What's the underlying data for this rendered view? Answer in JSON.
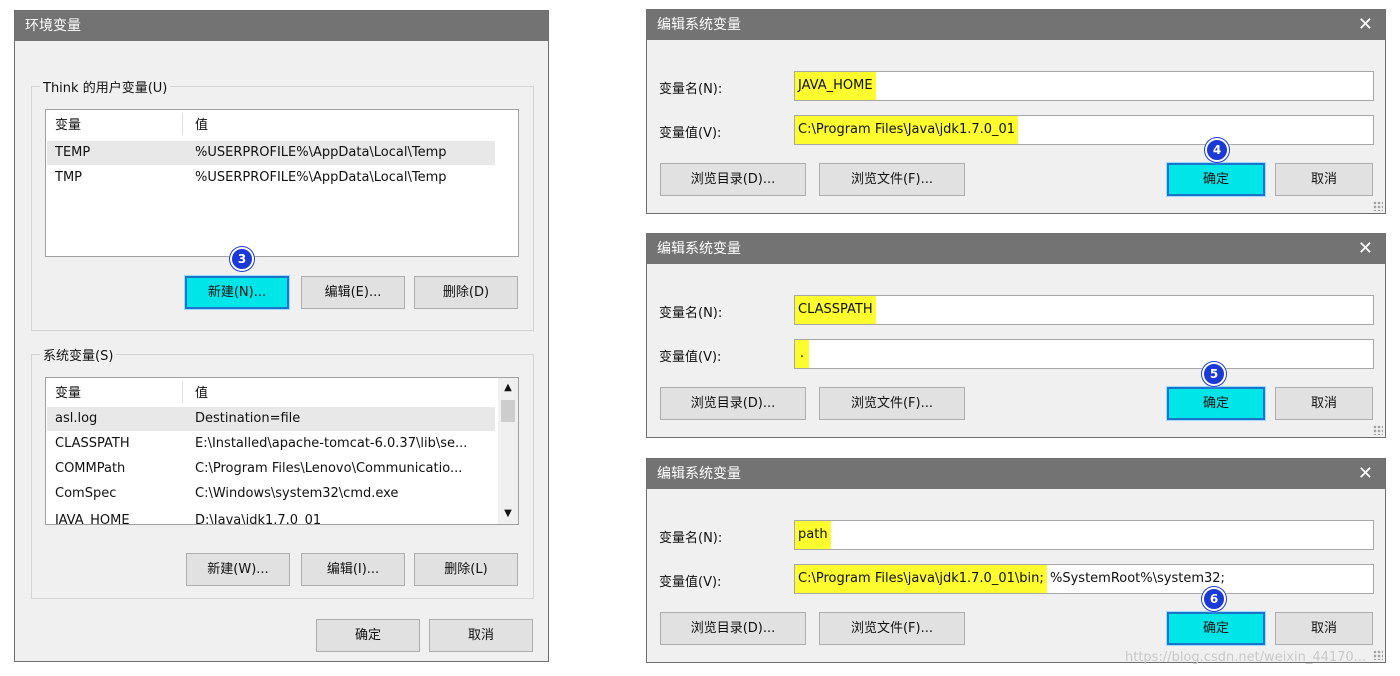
{
  "env_dialog": {
    "title": "环境变量",
    "user_group_title": "Think 的用户变量(U)",
    "user_headers": [
      "变量",
      "值"
    ],
    "user_rows": [
      {
        "name": "TEMP",
        "value": "%USERPROFILE%\\AppData\\Local\\Temp"
      },
      {
        "name": "TMP",
        "value": "%USERPROFILE%\\AppData\\Local\\Temp"
      }
    ],
    "user_buttons": {
      "new": "新建(N)...",
      "edit": "编辑(E)...",
      "delete": "删除(D)"
    },
    "sys_group_title": "系统变量(S)",
    "sys_headers": [
      "变量",
      "值"
    ],
    "sys_rows": [
      {
        "name": "asl.log",
        "value": "Destination=file"
      },
      {
        "name": "CLASSPATH",
        "value": "E:\\Installed\\apache-tomcat-6.0.37\\lib\\se..."
      },
      {
        "name": "COMMPath",
        "value": "C:\\Program Files\\Lenovo\\Communicatio..."
      },
      {
        "name": "ComSpec",
        "value": "C:\\Windows\\system32\\cmd.exe"
      },
      {
        "name": "JAVA_HOME",
        "value": "D:\\Java\\jdk1.7.0_01"
      }
    ],
    "sys_buttons": {
      "new": "新建(W)...",
      "edit": "编辑(I)...",
      "delete": "删除(L)"
    },
    "ok": "确定",
    "cancel": "取消"
  },
  "edit_dialogs": [
    {
      "title": "编辑系统变量",
      "name_label": "变量名(N):",
      "value_label": "变量值(V):",
      "name_value": "JAVA_HOME",
      "value_highlight": "C:\\Program Files\\Java\\jdk1.7.0_01",
      "value_rest": "",
      "browse_dir": "浏览目录(D)...",
      "browse_file": "浏览文件(F)...",
      "ok": "确定",
      "cancel": "取消",
      "step": "4"
    },
    {
      "title": "编辑系统变量",
      "name_label": "变量名(N):",
      "value_label": "变量值(V):",
      "name_value": "CLASSPATH",
      "value_highlight": ".",
      "value_rest": "",
      "browse_dir": "浏览目录(D)...",
      "browse_file": "浏览文件(F)...",
      "ok": "确定",
      "cancel": "取消",
      "step": "5"
    },
    {
      "title": "编辑系统变量",
      "name_label": "变量名(N):",
      "value_label": "变量值(V):",
      "name_value": "path",
      "value_highlight": "C:\\Program Files\\java\\jdk1.7.0_01\\bin;",
      "value_rest": "%SystemRoot%\\system32;",
      "browse_dir": "浏览目录(D)...",
      "browse_file": "浏览文件(F)...",
      "ok": "确定",
      "cancel": "取消",
      "step": "6"
    }
  ],
  "env_step": "3",
  "close_glyph": "✕",
  "watermark": "https://blog.csdn.net/weixin_44170...",
  "colors": {
    "highlight_yellow": "#fcfc2e",
    "highlight_cyan": "#00e5e8",
    "badge_blue": "#1a39d6",
    "titlebar": "#737373"
  }
}
